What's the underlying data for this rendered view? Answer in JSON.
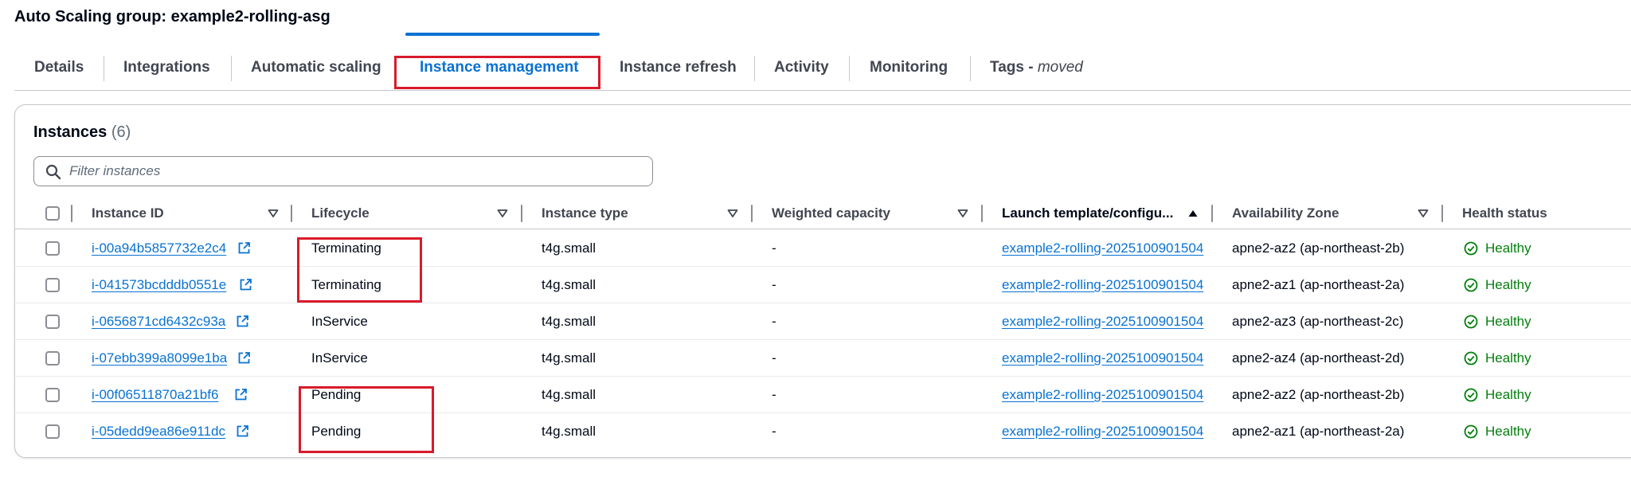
{
  "page": {
    "title": "Auto Scaling group: example2-rolling-asg"
  },
  "tabs": [
    {
      "label": "Details",
      "active": false
    },
    {
      "label": "Integrations",
      "active": false
    },
    {
      "label": "Automatic scaling",
      "active": false
    },
    {
      "label": "Instance management",
      "active": true
    },
    {
      "label": "Instance refresh",
      "active": false
    },
    {
      "label": "Activity",
      "active": false
    },
    {
      "label": "Monitoring",
      "active": false
    },
    {
      "label": "Tags - ",
      "suffix": "moved",
      "active": false
    }
  ],
  "instances": {
    "title": "Instances",
    "count": "(6)",
    "filter_placeholder": "Filter instances",
    "filter_value": "",
    "columns": [
      "Instance ID",
      "Lifecycle",
      "Instance type",
      "Weighted capacity",
      "Launch template/configu...",
      "Availability Zone",
      "Health status"
    ],
    "rows": [
      {
        "id": "i-00a94b5857732e2c4",
        "lifecycle": "Terminating",
        "type": "t4g.small",
        "weighted": "-",
        "template": "example2-rolling-2025100901504",
        "az": "apne2-az2 (ap-northeast-2b)",
        "health": "Healthy"
      },
      {
        "id": "i-041573bcdddb0551e",
        "lifecycle": "Terminating",
        "type": "t4g.small",
        "weighted": "-",
        "template": "example2-rolling-2025100901504",
        "az": "apne2-az1 (ap-northeast-2a)",
        "health": "Healthy"
      },
      {
        "id": "i-0656871cd6432c93a",
        "lifecycle": "InService",
        "type": "t4g.small",
        "weighted": "-",
        "template": "example2-rolling-2025100901504",
        "az": "apne2-az3 (ap-northeast-2c)",
        "health": "Healthy"
      },
      {
        "id": "i-07ebb399a8099e1ba",
        "lifecycle": "InService",
        "type": "t4g.small",
        "weighted": "-",
        "template": "example2-rolling-2025100901504",
        "az": "apne2-az4 (ap-northeast-2d)",
        "health": "Healthy"
      },
      {
        "id": "i-00f06511870a21bf6",
        "lifecycle": "Pending",
        "type": "t4g.small",
        "weighted": "-",
        "template": "example2-rolling-2025100901504",
        "az": "apne2-az2 (ap-northeast-2b)",
        "health": "Healthy"
      },
      {
        "id": "i-05dedd9ea86e911dc",
        "lifecycle": "Pending",
        "type": "t4g.small",
        "weighted": "-",
        "template": "example2-rolling-2025100901504",
        "az": "apne2-az1 (ap-northeast-2a)",
        "health": "Healthy"
      }
    ]
  },
  "colors": {
    "link": "#0972d3",
    "healthy": "#037f0c",
    "annotation": "#d91a2a",
    "text": "#000716"
  },
  "icons": {
    "search": "search-icon",
    "external": "external-link-icon",
    "healthy": "status-positive-icon",
    "sort_desc": "caret-down-filled-icon",
    "sort_asc": "caret-up-filled-icon"
  }
}
